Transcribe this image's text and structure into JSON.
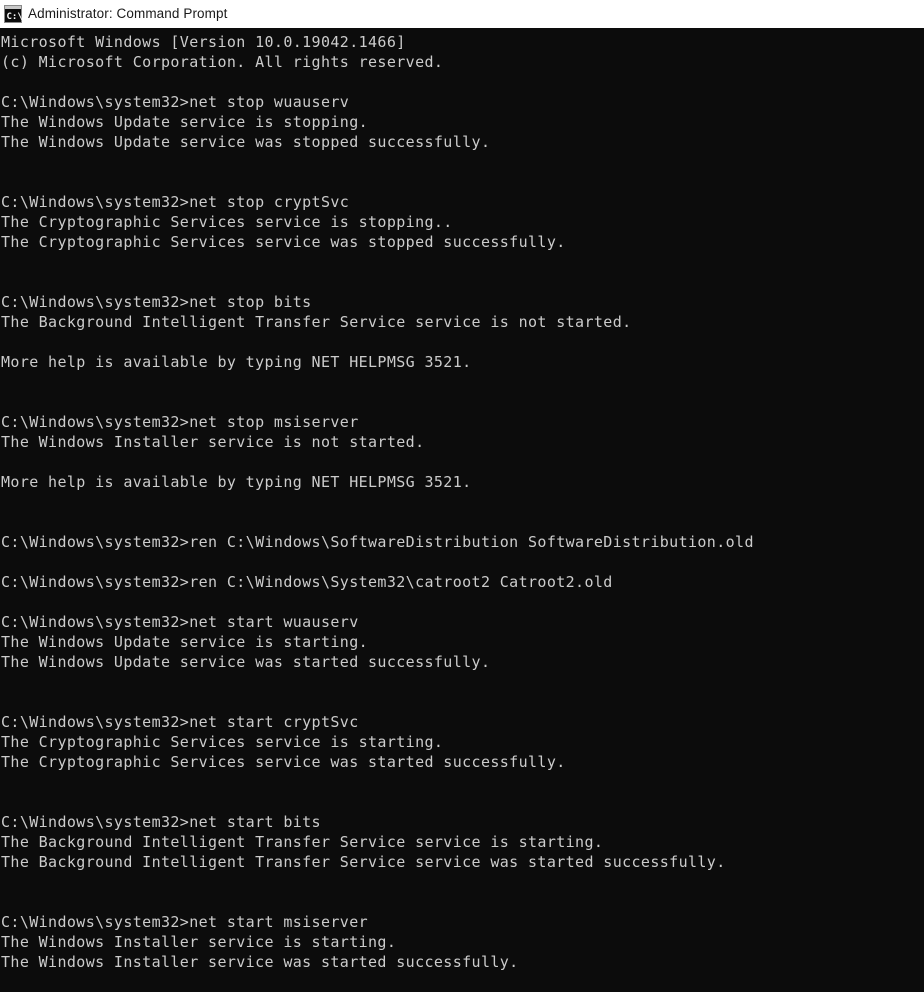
{
  "window": {
    "title": "Administrator: Command Prompt",
    "icon": "command-prompt-icon",
    "icon_text": "C:\\",
    "background_color": "#0c0c0c",
    "foreground_color": "#cccccc",
    "titlebar_background_color": "#ffffff",
    "titlebar_text_color": "#1a1a1a"
  },
  "console": {
    "prompt": "C:\\Windows\\system32>",
    "banner": [
      "Microsoft Windows [Version 10.0.19042.1466]",
      "(c) Microsoft Corporation. All rights reserved."
    ],
    "version": "10.0.19042.1466",
    "commands": [
      "net stop wuauserv",
      "net stop cryptSvc",
      "net stop bits",
      "net stop msiserver",
      "ren C:\\Windows\\SoftwareDistribution SoftwareDistribution.old",
      "ren C:\\Windows\\System32\\catroot2 Catroot2.old",
      "net start wuauserv",
      "net start cryptSvc",
      "net start bits",
      "net start msiserver"
    ],
    "lines": [
      "Microsoft Windows [Version 10.0.19042.1466]",
      "(c) Microsoft Corporation. All rights reserved.",
      "",
      "C:\\Windows\\system32>net stop wuauserv",
      "The Windows Update service is stopping.",
      "The Windows Update service was stopped successfully.",
      "",
      "",
      "C:\\Windows\\system32>net stop cryptSvc",
      "The Cryptographic Services service is stopping..",
      "The Cryptographic Services service was stopped successfully.",
      "",
      "",
      "C:\\Windows\\system32>net stop bits",
      "The Background Intelligent Transfer Service service is not started.",
      "",
      "More help is available by typing NET HELPMSG 3521.",
      "",
      "",
      "C:\\Windows\\system32>net stop msiserver",
      "The Windows Installer service is not started.",
      "",
      "More help is available by typing NET HELPMSG 3521.",
      "",
      "",
      "C:\\Windows\\system32>ren C:\\Windows\\SoftwareDistribution SoftwareDistribution.old",
      "",
      "C:\\Windows\\system32>ren C:\\Windows\\System32\\catroot2 Catroot2.old",
      "",
      "C:\\Windows\\system32>net start wuauserv",
      "The Windows Update service is starting.",
      "The Windows Update service was started successfully.",
      "",
      "",
      "C:\\Windows\\system32>net start cryptSvc",
      "The Cryptographic Services service is starting.",
      "The Cryptographic Services service was started successfully.",
      "",
      "",
      "C:\\Windows\\system32>net start bits",
      "The Background Intelligent Transfer Service service is starting.",
      "The Background Intelligent Transfer Service service was started successfully.",
      "",
      "",
      "C:\\Windows\\system32>net start msiserver",
      "The Windows Installer service is starting.",
      "The Windows Installer service was started successfully."
    ]
  }
}
